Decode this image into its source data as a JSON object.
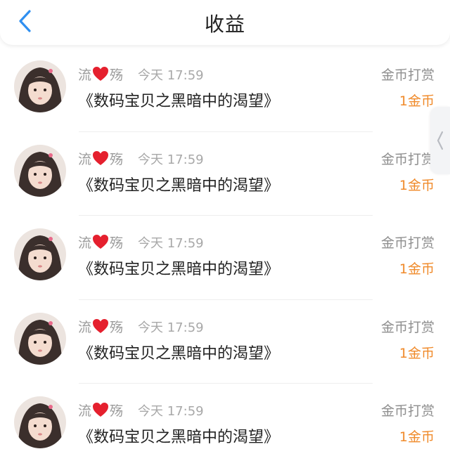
{
  "header": {
    "title": "收益",
    "back_icon": "chevron-left-icon",
    "accent_color": "#2f8ff0"
  },
  "side_tab": {
    "icon": "chevron-left-icon"
  },
  "records": [
    {
      "name_part1": "流",
      "name_part2": "殇",
      "time": "今天 17:59",
      "book": "《数码宝贝之黑暗中的渴望》",
      "type": "金币打赏",
      "amount": "1金币"
    },
    {
      "name_part1": "流",
      "name_part2": "殇",
      "time": "今天 17:59",
      "book": "《数码宝贝之黑暗中的渴望》",
      "type": "金币打赏",
      "amount": "1金币"
    },
    {
      "name_part1": "流",
      "name_part2": "殇",
      "time": "今天 17:59",
      "book": "《数码宝贝之黑暗中的渴望》",
      "type": "金币打赏",
      "amount": "1金币"
    },
    {
      "name_part1": "流",
      "name_part2": "殇",
      "time": "今天 17:59",
      "book": "《数码宝贝之黑暗中的渴望》",
      "type": "金币打赏",
      "amount": "1金币"
    },
    {
      "name_part1": "流",
      "name_part2": "殇",
      "time": "今天 17:59",
      "book": "《数码宝贝之黑暗中的渴望》",
      "type": "金币打赏",
      "amount": "1金币"
    }
  ],
  "colors": {
    "amount": "#f08a2a",
    "heart": "#e5202e"
  }
}
